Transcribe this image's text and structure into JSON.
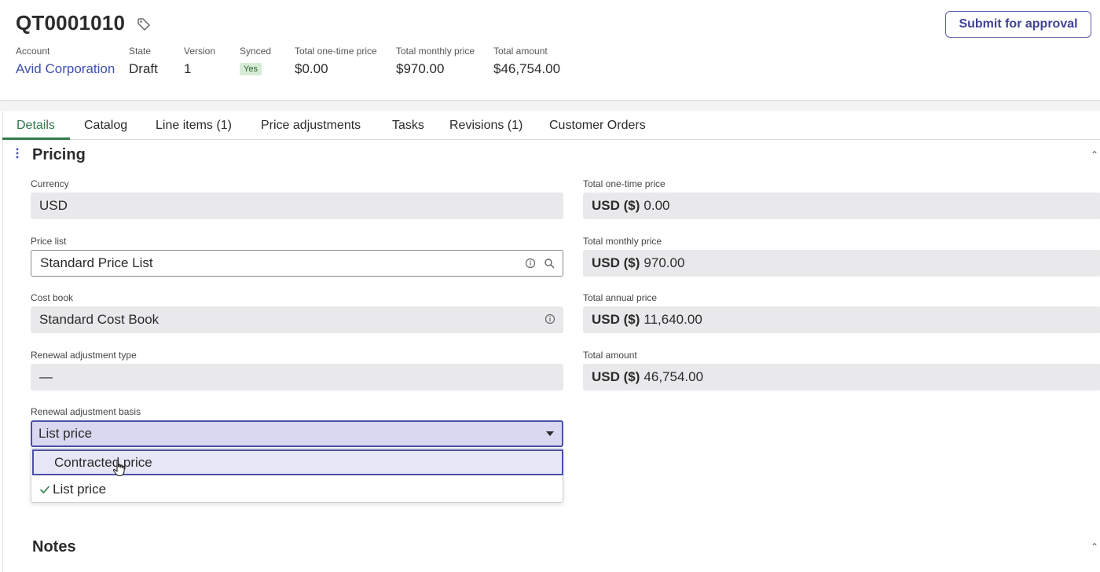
{
  "quote": {
    "number": "QT0001010",
    "submit_label": "Submit for approval"
  },
  "meta": {
    "account": {
      "label": "Account",
      "value": "Avid Corporation"
    },
    "state": {
      "label": "State",
      "value": "Draft"
    },
    "version": {
      "label": "Version",
      "value": "1"
    },
    "synced": {
      "label": "Synced",
      "value": "Yes"
    },
    "one_time": {
      "label": "Total one-time price",
      "value": "$0.00"
    },
    "monthly": {
      "label": "Total monthly price",
      "value": "$970.00"
    },
    "amount": {
      "label": "Total amount",
      "value": "$46,754.00"
    }
  },
  "tabs": [
    {
      "label": "Details"
    },
    {
      "label": "Catalog"
    },
    {
      "label": "Line items (1)"
    },
    {
      "label": "Price adjustments"
    },
    {
      "label": "Tasks"
    },
    {
      "label": "Revisions (1)"
    },
    {
      "label": "Customer Orders"
    }
  ],
  "pricing": {
    "title": "Pricing",
    "currency": {
      "label": "Currency",
      "value": "USD"
    },
    "price_list": {
      "label": "Price list",
      "value": "Standard Price List"
    },
    "cost_book": {
      "label": "Cost book",
      "value": "Standard Cost Book"
    },
    "renewal_type": {
      "label": "Renewal adjustment type",
      "value": "—"
    },
    "renewal_basis": {
      "label": "Renewal adjustment basis",
      "value": "List price",
      "options": [
        {
          "label": "Contracted price"
        },
        {
          "label": "List price"
        }
      ]
    },
    "currency_prefix": "USD ($)",
    "total_one_time": {
      "label": "Total one-time price",
      "value": "0.00"
    },
    "total_monthly": {
      "label": "Total monthly price",
      "value": "970.00"
    },
    "total_annual": {
      "label": "Total annual price",
      "value": "11,640.00"
    },
    "total_amount": {
      "label": "Total amount",
      "value": "46,754.00"
    }
  },
  "notes": {
    "title": "Notes"
  },
  "colors": {
    "accent": "#4b4fa8",
    "active_tab": "#2e7a4a",
    "link": "#3f4fb0"
  }
}
